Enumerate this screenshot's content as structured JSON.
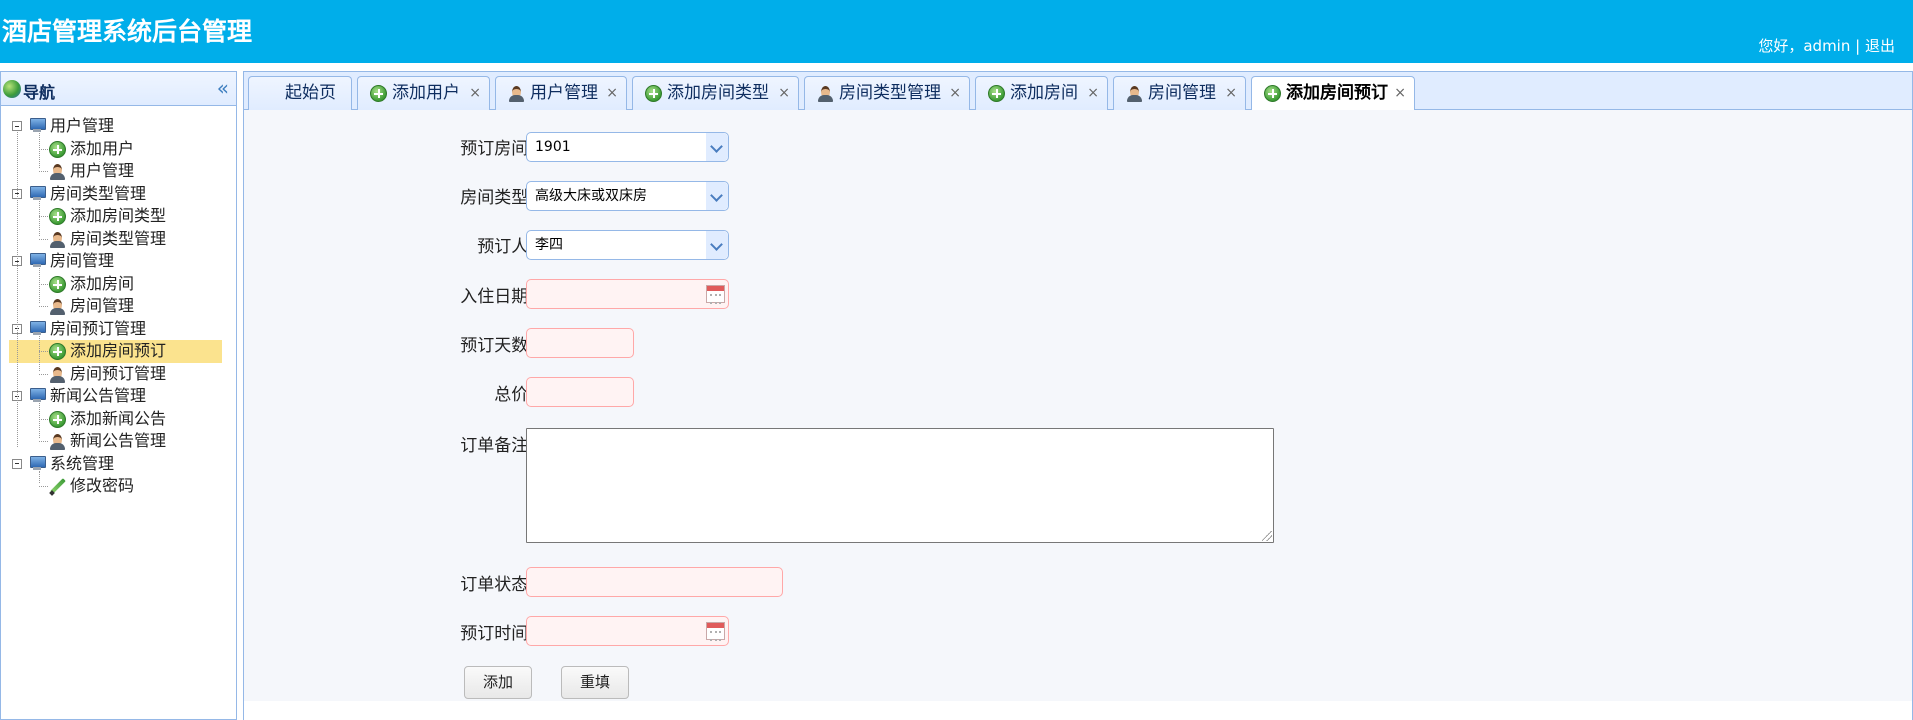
{
  "header": {
    "title": "酒店管理系统后台管理",
    "greeting": "您好，",
    "username": "admin",
    "separator": "|",
    "logout": "退出"
  },
  "sidebar": {
    "title": "导航",
    "collapse_glyph": "«",
    "groups": [
      {
        "label": "用户管理",
        "items": [
          {
            "label": "添加用户",
            "icon": "plus-icon"
          },
          {
            "label": "用户管理",
            "icon": "user-icon"
          }
        ]
      },
      {
        "label": "房间类型管理",
        "items": [
          {
            "label": "添加房间类型",
            "icon": "plus-icon"
          },
          {
            "label": "房间类型管理",
            "icon": "user-icon"
          }
        ]
      },
      {
        "label": "房间管理",
        "items": [
          {
            "label": "添加房间",
            "icon": "plus-icon"
          },
          {
            "label": "房间管理",
            "icon": "user-icon"
          }
        ]
      },
      {
        "label": "房间预订管理",
        "items": [
          {
            "label": "添加房间预订",
            "icon": "plus-icon",
            "selected": true
          },
          {
            "label": "房间预订管理",
            "icon": "user-icon"
          }
        ]
      },
      {
        "label": "新闻公告管理",
        "items": [
          {
            "label": "添加新闻公告",
            "icon": "plus-icon"
          },
          {
            "label": "新闻公告管理",
            "icon": "user-icon"
          }
        ]
      },
      {
        "label": "系统管理",
        "items": [
          {
            "label": "修改密码",
            "icon": "pencil-icon"
          }
        ]
      }
    ]
  },
  "tabs": [
    {
      "label": "起始页",
      "icon": "",
      "closable": false
    },
    {
      "label": "添加用户",
      "icon": "plus-icon",
      "closable": true
    },
    {
      "label": "用户管理",
      "icon": "user-icon",
      "closable": true
    },
    {
      "label": "添加房间类型",
      "icon": "plus-icon",
      "closable": true
    },
    {
      "label": "房间类型管理",
      "icon": "user-icon",
      "closable": true
    },
    {
      "label": "添加房间",
      "icon": "plus-icon",
      "closable": true
    },
    {
      "label": "房间管理",
      "icon": "user-icon",
      "closable": true
    },
    {
      "label": "添加房间预订",
      "icon": "plus-icon",
      "closable": true,
      "active": true
    }
  ],
  "tab_close_glyph": "×",
  "form": {
    "room_label": "预订房间:",
    "room_value": "1901",
    "roomtype_label": "房间类型:",
    "roomtype_value": "高级大床或双床房",
    "booker_label": "预订人:",
    "booker_value": "李四",
    "checkin_label": "入住日期:",
    "checkin_value": "",
    "days_label": "预订天数:",
    "days_value": "",
    "total_label": "总价:",
    "total_value": "",
    "remark_label": "订单备注:",
    "remark_value": "",
    "status_label": "订单状态:",
    "status_value": "",
    "booktime_label": "预订时间:",
    "booktime_value": "",
    "add_button": "添加",
    "reset_button": "重填"
  },
  "colors": {
    "header_bg": "#00aeea",
    "panel_border": "#95b8e7",
    "selected_bg": "#fbe38e",
    "invalid_border": "#ffa8a8"
  }
}
